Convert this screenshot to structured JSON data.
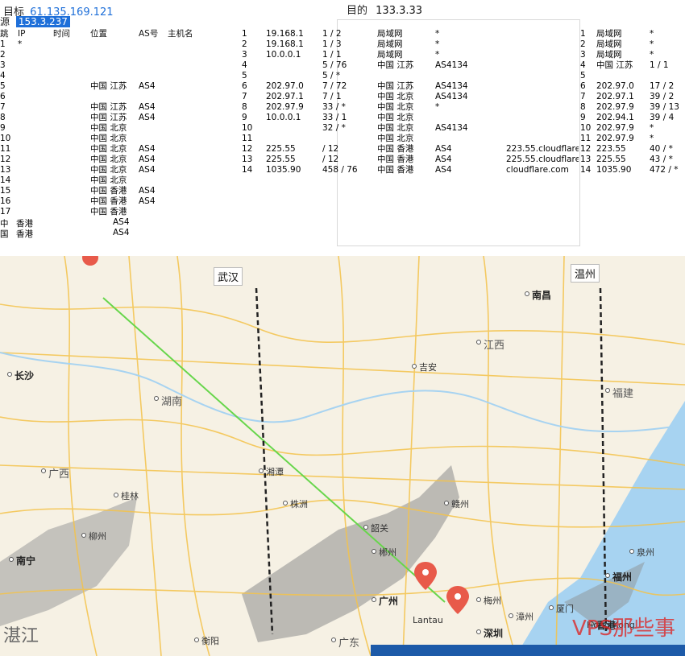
{
  "trace": {
    "left_title_prefix": "目标",
    "left_title_ip": "61.135.169.121",
    "left_sub_prefix": "源",
    "left_sub_ip": "153.3.237",
    "columns": [
      "跳",
      "IP",
      "时间",
      "位置",
      "AS号",
      "主机名"
    ],
    "rows": [
      {
        "hop": "1",
        "ip": "*",
        "time": "",
        "loc": "",
        "as": "",
        "host": ""
      },
      {
        "hop": "2",
        "ip": "",
        "time": "",
        "loc": "",
        "as": "",
        "host": ""
      },
      {
        "hop": "3",
        "ip": "",
        "time": "",
        "loc": "",
        "as": "",
        "host": ""
      },
      {
        "hop": "4",
        "ip": "",
        "time": "",
        "loc": "",
        "as": "",
        "host": ""
      },
      {
        "hop": "5",
        "ip": "",
        "time": "",
        "loc": "中国 江苏",
        "as": "AS4",
        "host": ""
      },
      {
        "hop": "6",
        "ip": "",
        "time": "",
        "loc": "",
        "as": "",
        "host": ""
      },
      {
        "hop": "7",
        "ip": "",
        "time": "",
        "loc": "中国 江苏",
        "as": "AS4",
        "host": ""
      },
      {
        "hop": "8",
        "ip": "",
        "time": "",
        "loc": "中国 江苏",
        "as": "AS4",
        "host": ""
      },
      {
        "hop": "9",
        "ip": "",
        "time": "",
        "loc": "中国 北京",
        "as": "",
        "host": ""
      },
      {
        "hop": "10",
        "ip": "",
        "time": "",
        "loc": "中国 北京",
        "as": "",
        "host": ""
      },
      {
        "hop": "11",
        "ip": "",
        "time": "",
        "loc": "中国 北京",
        "as": "AS4",
        "host": ""
      },
      {
        "hop": "12",
        "ip": "",
        "time": "",
        "loc": "中国 北京",
        "as": "AS4",
        "host": ""
      },
      {
        "hop": "13",
        "ip": "",
        "time": "",
        "loc": "中国 北京",
        "as": "AS4",
        "host": ""
      },
      {
        "hop": "14",
        "ip": "",
        "time": "",
        "loc": "中国 北京",
        "as": "",
        "host": ""
      },
      {
        "hop": "15",
        "ip": "",
        "time": "",
        "loc": "中国 香港",
        "as": "AS4",
        "host": ""
      },
      {
        "hop": "16",
        "ip": "",
        "time": "",
        "loc": "中国 香港",
        "as": "AS4",
        "host": ""
      },
      {
        "hop": "17",
        "ip": "",
        "time": "",
        "loc": "中国 香港",
        "as": "",
        "host": ""
      }
    ],
    "right_title_prefix": "目的",
    "right_title_ip": "133.3.33",
    "mid_rows": [
      {
        "hop": "1",
        "ip": "19.168.1",
        "time": "1 / 2",
        "loc": "局域网",
        "as": "*",
        "host": ""
      },
      {
        "hop": "2",
        "ip": "19.168.1",
        "time": "1 / 3",
        "loc": "局域网",
        "as": "*",
        "host": ""
      },
      {
        "hop": "3",
        "ip": "10.0.0.1",
        "time": "1 / 1",
        "loc": "局域网",
        "as": "*",
        "host": ""
      },
      {
        "hop": "4",
        "ip": "",
        "time": "5 / 76",
        "loc": "中国 江苏",
        "as": "AS4134",
        "host": ""
      },
      {
        "hop": "5",
        "ip": "",
        "time": "5 / *",
        "loc": "",
        "as": "",
        "host": ""
      },
      {
        "hop": "6",
        "ip": "202.97.0",
        "time": "7 / 72",
        "loc": "中国 江苏",
        "as": "AS4134",
        "host": ""
      },
      {
        "hop": "7",
        "ip": "202.97.1",
        "time": "7 / 1",
        "loc": "中国 北京",
        "as": "AS4134",
        "host": ""
      },
      {
        "hop": "8",
        "ip": "202.97.9",
        "time": "33 / *",
        "loc": "中国 北京",
        "as": "*",
        "host": ""
      },
      {
        "hop": "9",
        "ip": "10.0.0.1",
        "time": "33 / 1",
        "loc": "中国 北京",
        "as": "",
        "host": ""
      },
      {
        "hop": "10",
        "ip": "",
        "time": "32 / *",
        "loc": "中国 北京",
        "as": "AS4134",
        "host": ""
      },
      {
        "hop": "11",
        "ip": "",
        "time": "",
        "loc": "中国 北京",
        "as": "",
        "host": ""
      },
      {
        "hop": "12",
        "ip": "225.55",
        "time": "/ 12",
        "loc": "中国 香港",
        "as": "AS4",
        "host": "223.55.cloudflare.com"
      },
      {
        "hop": "13",
        "ip": "225.55",
        "time": "/ 12",
        "loc": "中国 香港",
        "as": "AS4",
        "host": "225.55.cloudflare.com"
      },
      {
        "hop": "14",
        "ip": "1035.90",
        "time": "458 / 76",
        "loc": "中国 香港",
        "as": "AS4",
        "host": "cloudflare.com"
      }
    ],
    "far_rows": [
      {
        "hop": "1",
        "loc": "局域网",
        "time": "*"
      },
      {
        "hop": "2",
        "loc": "局域网",
        "time": "*"
      },
      {
        "hop": "3",
        "loc": "局域网",
        "time": "*"
      },
      {
        "hop": "4",
        "loc": "中国 江苏",
        "time": "1 / 1"
      },
      {
        "hop": "5",
        "loc": "",
        "time": ""
      },
      {
        "hop": "6",
        "loc": "202.97.0",
        "time": "17 / 2"
      },
      {
        "hop": "7",
        "loc": "202.97.1",
        "time": "39 / 2"
      },
      {
        "hop": "8",
        "loc": "202.97.9",
        "time": "39 / 13"
      },
      {
        "hop": "9",
        "loc": "202.94.1",
        "time": "39 / 4"
      },
      {
        "hop": "10",
        "loc": "202.97.9",
        "time": "*"
      },
      {
        "hop": "11",
        "loc": "202.97.9",
        "time": "*"
      },
      {
        "hop": "12",
        "loc": "223.55",
        "time": "40 / *"
      },
      {
        "hop": "13",
        "loc": "225.55",
        "time": "43 / *"
      },
      {
        "hop": "14",
        "loc": "1035.90",
        "time": "472 / *"
      }
    ],
    "bottom_rows": [
      {
        "hop": "中",
        "loc": "香港",
        "time": "",
        "as": "AS4"
      },
      {
        "hop": "国",
        "loc": "香港",
        "time": "",
        "as": "AS4"
      }
    ]
  },
  "map": {
    "places": [
      {
        "name": "长沙",
        "kind": "city"
      },
      {
        "name": "株洲",
        "kind": "place"
      },
      {
        "name": "湘潭",
        "kind": "place"
      },
      {
        "name": "衡阳",
        "kind": "place"
      },
      {
        "name": "郴州",
        "kind": "place"
      },
      {
        "name": "赣州",
        "kind": "place"
      },
      {
        "name": "吉安",
        "kind": "place"
      },
      {
        "name": "南昌",
        "kind": "city"
      },
      {
        "name": "福州",
        "kind": "city"
      },
      {
        "name": "厦门",
        "kind": "place"
      },
      {
        "name": "泉州",
        "kind": "place"
      },
      {
        "name": "漳州",
        "kind": "place"
      },
      {
        "name": "梅州",
        "kind": "place"
      },
      {
        "name": "韶关",
        "kind": "place"
      },
      {
        "name": "广州",
        "kind": "city"
      },
      {
        "name": "深圳",
        "kind": "city"
      },
      {
        "name": "香港",
        "kind": "city"
      },
      {
        "name": "桂林",
        "kind": "place"
      },
      {
        "name": "柳州",
        "kind": "place"
      },
      {
        "name": "南宁",
        "kind": "city"
      },
      {
        "name": "湖南",
        "kind": "region"
      },
      {
        "name": "江西",
        "kind": "region"
      },
      {
        "name": "广东",
        "kind": "region"
      },
      {
        "name": "福建",
        "kind": "region"
      },
      {
        "name": "广西",
        "kind": "region"
      }
    ],
    "controls": {
      "left_label": "武汉",
      "right_label": "温州"
    },
    "bottom_labels": {
      "left": "湛江",
      "mid": "Lantau",
      "right": "Hong Kong"
    },
    "watermark": "VPS那些事",
    "colors": {
      "land": "#f6f1e4",
      "sea": "#a7d3f1",
      "road": "#f4c34b",
      "route_green": "#67d64b",
      "route_black": "#222222",
      "pin": "#e85a4a"
    }
  }
}
